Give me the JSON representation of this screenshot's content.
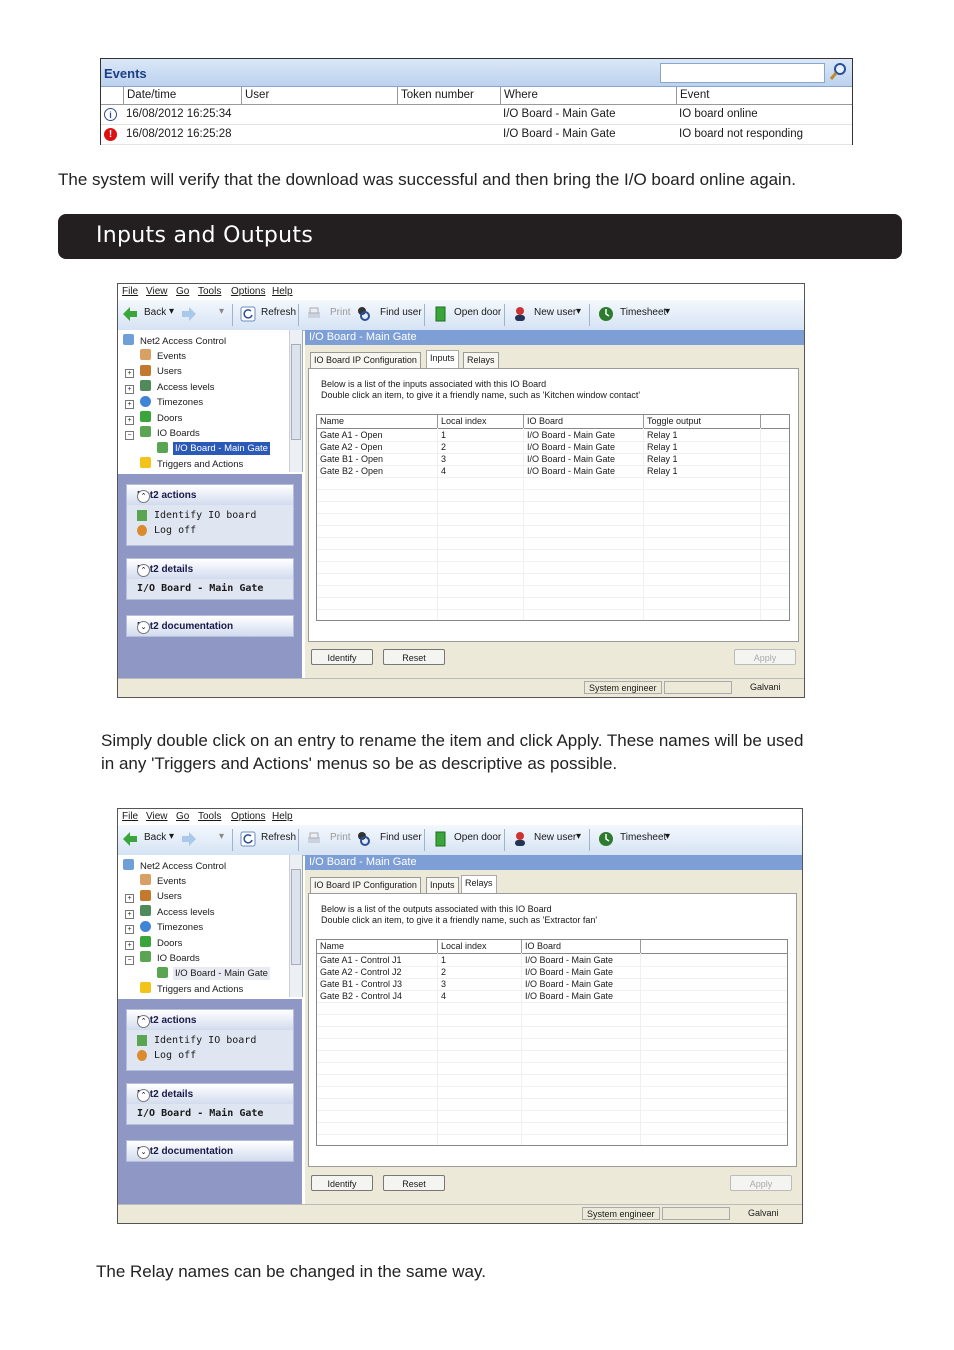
{
  "events": {
    "title": "Events",
    "columns": [
      "Date/time",
      "User",
      "Token number",
      "Where",
      "Event"
    ],
    "rows": [
      {
        "icon": "info-icon",
        "datetime": "16/08/2012  16:25:34",
        "user": "",
        "token": "",
        "where": "I/O Board - Main Gate",
        "event": "IO board online"
      },
      {
        "icon": "error-icon",
        "datetime": "16/08/2012  16:25:28",
        "user": "",
        "token": "",
        "where": "I/O Board - Main Gate",
        "event": "IO board not responding"
      }
    ]
  },
  "text1": "The system will verify that the download was successful and then bring the I/O board online again.",
  "section_title": "Inputs and Outputs",
  "text2_line1": "Simply double click on an entry to rename the item and click Apply. These names will be used",
  "text2_line2": "in any 'Triggers and Actions' menus so be as descriptive as possible.",
  "text3": "The Relay names can be changed in the same way.",
  "app": {
    "menu": [
      "File",
      "View",
      "Go",
      "Tools",
      "Options",
      "Help"
    ],
    "toolbar": {
      "back": "Back",
      "print": "Print",
      "refresh": "Refresh",
      "find_user": "Find user",
      "open_door": "Open door",
      "new_user": "New user",
      "timesheet": "Timesheet"
    },
    "tree": {
      "root": "Net2 Access Control",
      "events": "Events",
      "users": "Users",
      "access_levels": "Access levels",
      "timezones": "Timezones",
      "doors": "Doors",
      "io_boards": "IO Boards",
      "io_board_main": "I/O Board - Main Gate",
      "triggers": "Triggers and Actions"
    },
    "actions_title": "Net2 actions",
    "action_identify": "Identify IO board",
    "action_logoff": "Log off",
    "details_title": "Net2 details",
    "details_value": "I/O Board - Main Gate",
    "docs_title": "Net2 documentation",
    "main_title": "I/O Board - Main Gate",
    "tabs": {
      "config": "IO Board IP Configuration",
      "inputs": "Inputs",
      "relays": "Relays"
    },
    "btn_identify": "Identify",
    "btn_reset": "Reset",
    "btn_apply": "Apply",
    "status_role": "System engineer",
    "status_user": "Galvani"
  },
  "inputs": {
    "desc1": "Below is a list of the inputs associated with this IO Board",
    "desc2": "Double click an item, to give it a friendly name, such as 'Kitchen window contact'",
    "columns": [
      "Name",
      "Local index",
      "IO Board",
      "Toggle output"
    ],
    "rows": [
      [
        "Gate A1 - Open",
        "1",
        "I/O Board - Main Gate",
        "Relay 1"
      ],
      [
        "Gate A2 - Open",
        "2",
        "I/O Board - Main Gate",
        "Relay 1"
      ],
      [
        "Gate B1 - Open",
        "3",
        "I/O Board - Main Gate",
        "Relay 1"
      ],
      [
        "Gate B2 - Open",
        "4",
        "I/O Board - Main Gate",
        "Relay 1"
      ]
    ]
  },
  "relays": {
    "desc1": "Below is a list of the outputs associated with this IO Board",
    "desc2": "Double click an item, to give it a friendly name, such as 'Extractor fan'",
    "columns": [
      "Name",
      "Local index",
      "IO Board"
    ],
    "rows": [
      [
        "Gate A1 - Control J1",
        "1",
        "I/O Board - Main Gate"
      ],
      [
        "Gate A2 - Control J2",
        "2",
        "I/O Board - Main Gate"
      ],
      [
        "Gate B1 - Control J3",
        "3",
        "I/O Board - Main Gate"
      ],
      [
        "Gate B2 - Control J4",
        "4",
        "I/O Board - Main Gate"
      ]
    ]
  }
}
